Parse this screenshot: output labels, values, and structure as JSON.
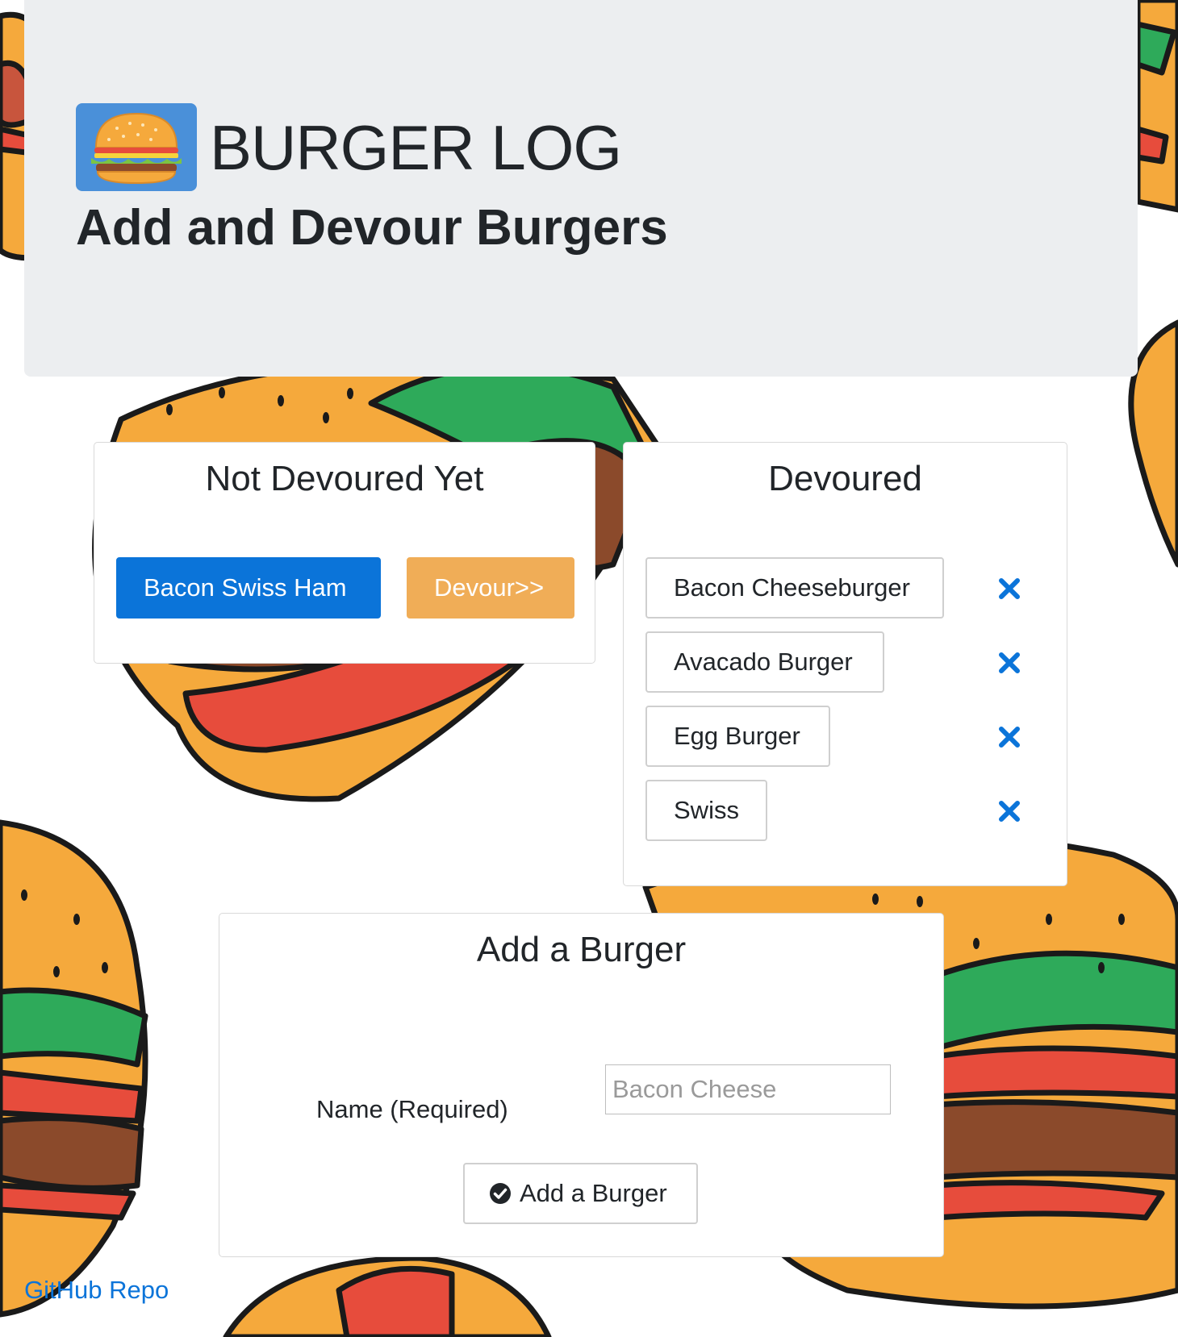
{
  "header": {
    "title": "BURGER LOG",
    "subtitle": "Add and Devour Burgers",
    "logo_icon": "hamburger-icon"
  },
  "not_devoured": {
    "heading": "Not Devoured Yet",
    "items": [
      {
        "name": "Bacon Swiss Ham",
        "action_label": "Devour>>"
      }
    ]
  },
  "devoured": {
    "heading": "Devoured",
    "items": [
      {
        "name": "Bacon Cheeseburger",
        "remove_icon": "x-icon"
      },
      {
        "name": "Avacado Burger",
        "remove_icon": "x-icon"
      },
      {
        "name": "Egg Burger",
        "remove_icon": "x-icon"
      },
      {
        "name": "Swiss",
        "remove_icon": "x-icon"
      }
    ]
  },
  "add_form": {
    "heading": "Add a Burger",
    "name_label": "Name (Required)",
    "name_placeholder": "Bacon Cheese",
    "name_value": "",
    "submit_label": "Add a Burger",
    "submit_icon": "check-circle-icon"
  },
  "footer": {
    "link_label": "GitHub Repo"
  },
  "colors": {
    "primary": "#0b74d9",
    "warning": "#f0ad57",
    "jumbotron_bg": "#eceef0",
    "logo_bg": "#4a90d9"
  }
}
